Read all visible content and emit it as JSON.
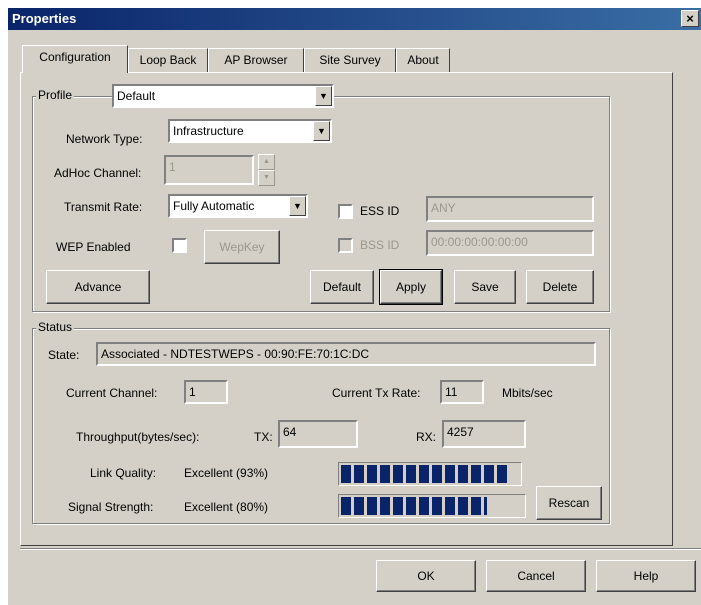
{
  "window": {
    "title": "Properties",
    "close_glyph": "×"
  },
  "tabs": [
    {
      "label": "Configuration",
      "active": true
    },
    {
      "label": "Loop Back",
      "active": false
    },
    {
      "label": "AP Browser",
      "active": false
    },
    {
      "label": "Site Survey",
      "active": false
    },
    {
      "label": "About",
      "active": false
    }
  ],
  "profile": {
    "group_label": "Profile",
    "value": "Default",
    "network_type_label": "Network Type:",
    "network_type_value": "Infrastructure",
    "adhoc_channel_label": "AdHoc Channel:",
    "adhoc_channel_value": "1",
    "transmit_rate_label": "Transmit Rate:",
    "transmit_rate_value": "Fully Automatic",
    "essid_label": "ESS ID",
    "essid_value": "ANY",
    "bssid_label": "BSS ID",
    "bssid_value": "00:00:00:00:00:00",
    "wep_enabled_label": "WEP Enabled",
    "wepkey_button": "WepKey",
    "advance_button": "Advance",
    "default_button": "Default",
    "apply_button": "Apply",
    "save_button": "Save",
    "delete_button": "Delete"
  },
  "status": {
    "group_label": "Status",
    "state_label": "State:",
    "state_value": "Associated - NDTESTWEPS - 00:90:FE:70:1C:DC",
    "current_channel_label": "Current Channel:",
    "current_channel_value": "1",
    "current_tx_rate_label": "Current Tx Rate:",
    "current_tx_rate_value": "11",
    "tx_rate_unit": "Mbits/sec",
    "throughput_label": "Throughput(bytes/sec):",
    "tx_label": "TX:",
    "tx_value": "64",
    "rx_label": "RX:",
    "rx_value": "4257",
    "link_quality_label": "Link Quality:",
    "link_quality_value": "Excellent (93%)",
    "link_quality_level": 0.93,
    "signal_strength_label": "Signal Strength:",
    "signal_strength_value": "Excellent (80%)",
    "signal_strength_level": 0.8,
    "rescan_button": "Rescan"
  },
  "footer": {
    "ok_button": "OK",
    "cancel_button": "Cancel",
    "help_button": "Help"
  },
  "icons": {
    "dropdown": "chevron-down-icon"
  },
  "colors": {
    "title_bar": "#0a246a",
    "meter_fill": "#0a246a",
    "dialog_bg": "#d4d0c8"
  }
}
